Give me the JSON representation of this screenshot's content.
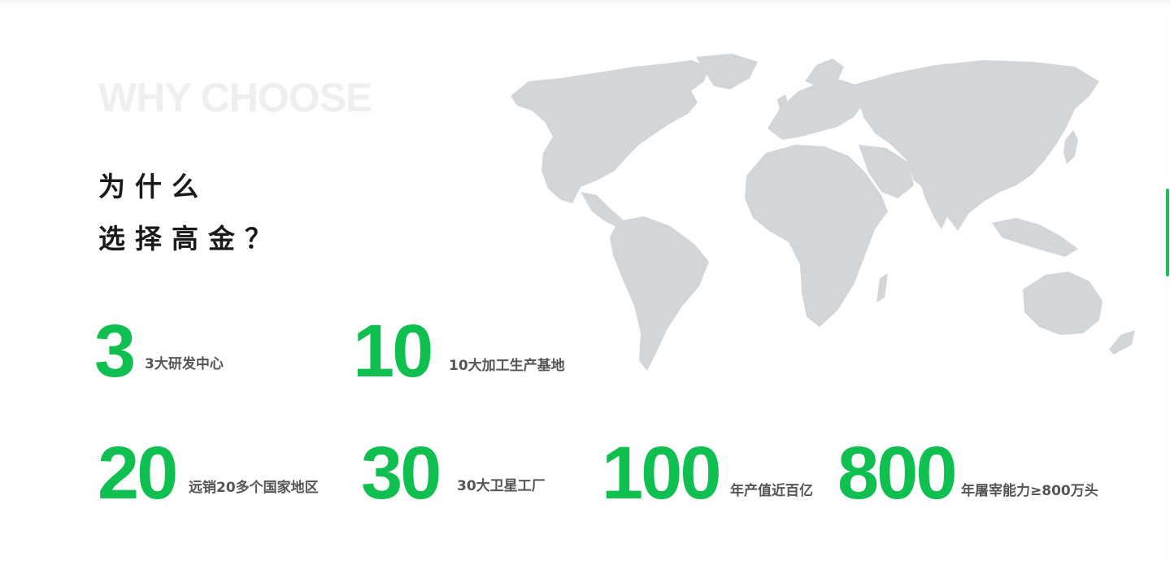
{
  "watermark": "WHY CHOOSE",
  "title": {
    "line1": "为什么",
    "line2": "选择高金？"
  },
  "map": {
    "name": "world-map",
    "land_color": "#d2d6d9"
  },
  "accent_color": "#0fbf4f",
  "stats": [
    {
      "number": "3",
      "label": "3大研发中心"
    },
    {
      "number": "10",
      "label": "10大加工生产基地"
    },
    {
      "number": "20",
      "label": "远销20多个国家地区"
    },
    {
      "number": "30",
      "label": "30大卫星工厂"
    },
    {
      "number": "100",
      "label": "年产值近百亿"
    },
    {
      "number": "800",
      "label": "年屠宰能力≥800万头"
    }
  ]
}
